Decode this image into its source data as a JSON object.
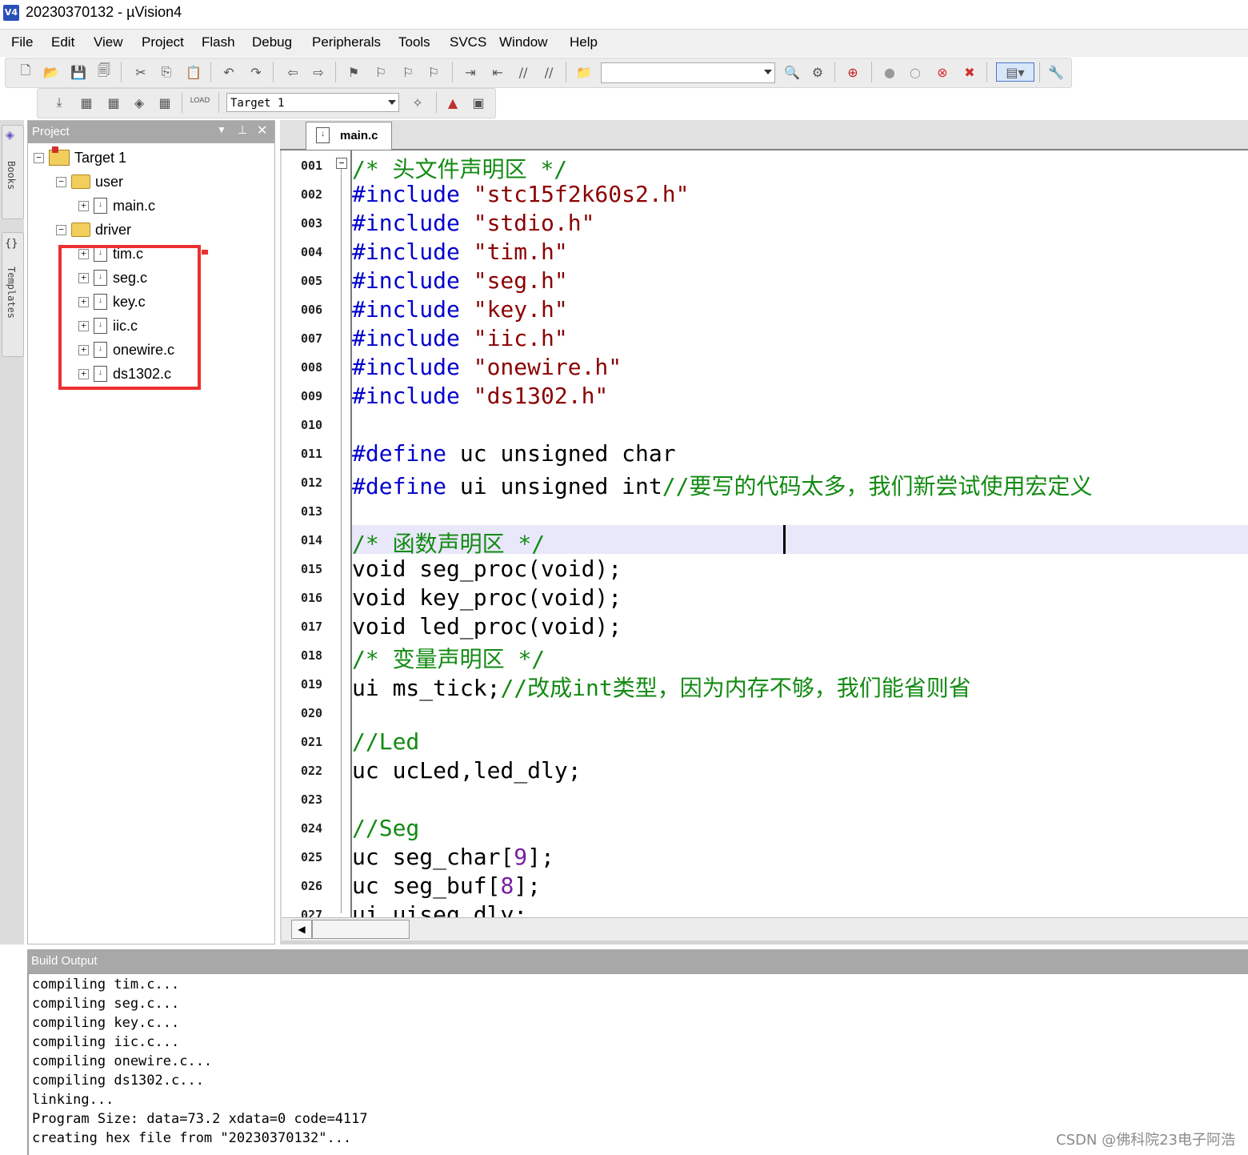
{
  "window": {
    "title": "20230370132  - µVision4",
    "logo": "V4"
  },
  "menu": [
    "File",
    "Edit",
    "View",
    "Project",
    "Flash",
    "Debug",
    "Peripherals",
    "Tools",
    "SVCS",
    "Window",
    "Help"
  ],
  "toolbar": {
    "target_combo": "Target 1",
    "load_label": "LOAD"
  },
  "side_tabs": [
    "Books",
    "Templates"
  ],
  "project_panel": {
    "title": "Project",
    "tree": [
      {
        "label": "Target 1",
        "type": "target"
      },
      {
        "label": "user",
        "type": "folder"
      },
      {
        "label": "main.c",
        "type": "file"
      },
      {
        "label": "driver",
        "type": "folder"
      },
      {
        "label": "tim.c",
        "type": "file"
      },
      {
        "label": "seg.c",
        "type": "file"
      },
      {
        "label": "key.c",
        "type": "file"
      },
      {
        "label": "iic.c",
        "type": "file"
      },
      {
        "label": "onewire.c",
        "type": "file"
      },
      {
        "label": "ds1302.c",
        "type": "file"
      }
    ]
  },
  "editor": {
    "tab": "main.c",
    "lines": [
      {
        "n": "001",
        "t": "/* 头文件声明区 */"
      },
      {
        "n": "002",
        "t": "#include \"stc15f2k60s2.h\""
      },
      {
        "n": "003",
        "t": "#include \"stdio.h\""
      },
      {
        "n": "004",
        "t": "#include \"tim.h\""
      },
      {
        "n": "005",
        "t": "#include \"seg.h\""
      },
      {
        "n": "006",
        "t": "#include \"key.h\""
      },
      {
        "n": "007",
        "t": "#include \"iic.h\""
      },
      {
        "n": "008",
        "t": "#include \"onewire.h\""
      },
      {
        "n": "009",
        "t": "#include \"ds1302.h\""
      },
      {
        "n": "010",
        "t": ""
      },
      {
        "n": "011",
        "t": "#define uc unsigned char"
      },
      {
        "n": "012",
        "t": "#define ui unsigned int//要写的代码太多，我们新尝试使用宏定义"
      },
      {
        "n": "013",
        "t": ""
      },
      {
        "n": "014",
        "t": "/* 函数声明区 */"
      },
      {
        "n": "015",
        "t": "void seg_proc(void);"
      },
      {
        "n": "016",
        "t": "void key_proc(void);"
      },
      {
        "n": "017",
        "t": "void led_proc(void);"
      },
      {
        "n": "018",
        "t": "/* 变量声明区 */"
      },
      {
        "n": "019",
        "t": "ui ms_tick;//改成int类型，因为内存不够，我们能省则省"
      },
      {
        "n": "020",
        "t": ""
      },
      {
        "n": "021",
        "t": "//Led"
      },
      {
        "n": "022",
        "t": "uc ucLed,led_dly;"
      },
      {
        "n": "023",
        "t": ""
      },
      {
        "n": "024",
        "t": "//Seg"
      },
      {
        "n": "025",
        "t": "uc seg_char[9];"
      },
      {
        "n": "026",
        "t": "uc seg_buf[8];"
      },
      {
        "n": "027",
        "t": "ui uiseg_dly;"
      }
    ]
  },
  "build_output": {
    "title": "Build Output",
    "lines": [
      "compiling tim.c...",
      "compiling seg.c...",
      "compiling key.c...",
      "compiling iic.c...",
      "compiling onewire.c...",
      "compiling ds1302.c...",
      "linking...",
      "Program Size: data=73.2 xdata=0 code=4117",
      "creating hex file from \"20230370132\"..."
    ]
  },
  "watermark": "CSDN @佛科院23电子阿浩",
  "colors": {
    "keyword": "#0000cc",
    "string": "#8b0000",
    "comment": "#128a12",
    "number": "#7a1ea0",
    "highlight_box": "#ec2f2f"
  }
}
